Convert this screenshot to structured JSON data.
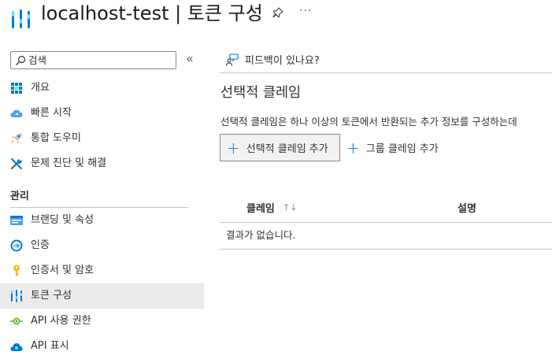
{
  "header": {
    "title": "localhost-test | 토큰 구성",
    "pin_icon": "pin-icon",
    "more_label": "···"
  },
  "sidebar": {
    "search_placeholder": "검색",
    "collapse_label": "«",
    "items": [
      {
        "label": "개요",
        "icon": "overview-grid-icon"
      },
      {
        "label": "빠른 시작",
        "icon": "cloud-quickstart-icon"
      },
      {
        "label": "통합 도우미",
        "icon": "rocket-icon"
      },
      {
        "label": "문제 진단 및 해결",
        "icon": "wrench-icon"
      }
    ],
    "section_title": "관리",
    "manage_items": [
      {
        "label": "브랜딩 및 속성",
        "icon": "branding-icon"
      },
      {
        "label": "인증",
        "icon": "authentication-icon"
      },
      {
        "label": "인증서 및 암호",
        "icon": "key-icon"
      },
      {
        "label": "토큰 구성",
        "icon": "token-bars-icon",
        "active": true
      },
      {
        "label": "API 사용 권한",
        "icon": "api-permissions-icon"
      },
      {
        "label": "API 표시",
        "icon": "expose-api-cloud-icon"
      }
    ]
  },
  "main": {
    "feedback_label": "피드백이 있나요?",
    "section_title": "선택적 클레임",
    "description": "선택적 클레임은 하나 이상의 토큰에서 반환되는 추가 정보를 구성하는데",
    "add_optional_claim": "선택적 클레임 추가",
    "add_groups_claim": "그룹 클레임 추가",
    "table": {
      "columns": [
        "클레임",
        "설명"
      ],
      "sort_indicator": "↑↓",
      "empty_message": "결과가 없습니다."
    }
  },
  "colors": {
    "accent": "#0078d4",
    "active_item_bg": "#edebe9",
    "border": "#c8c6c4"
  }
}
